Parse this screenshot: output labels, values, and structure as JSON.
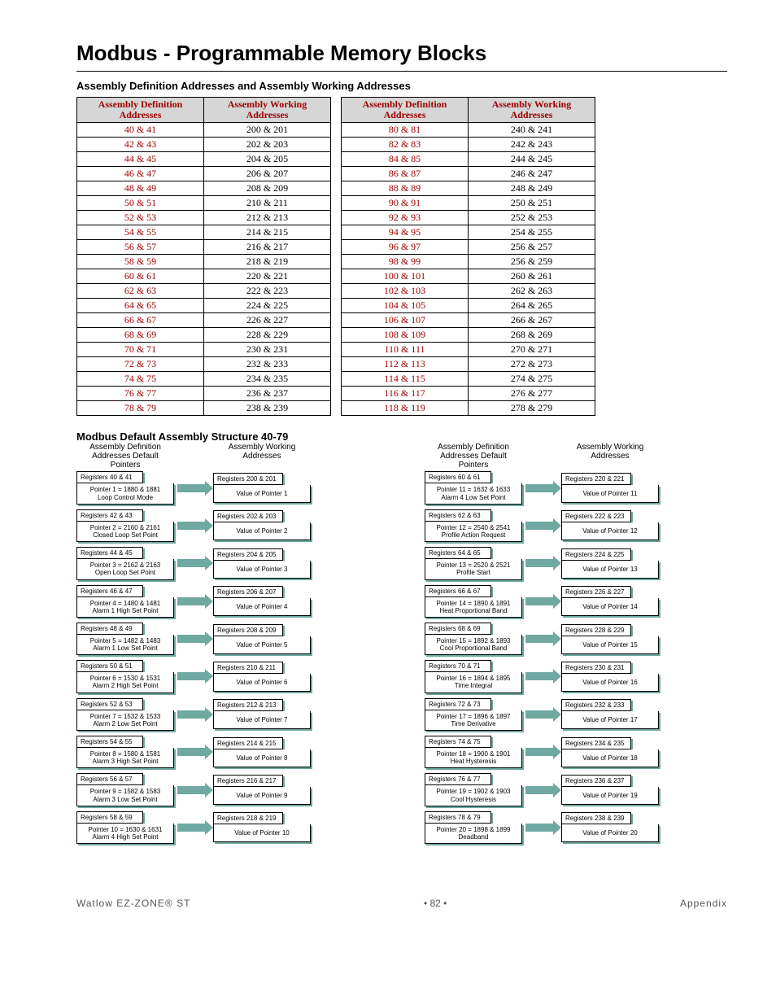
{
  "title": "Modbus - Programmable Memory Blocks",
  "subtitle1": "Assembly Definition Addresses and Assembly Working Addresses",
  "th_def": "Assembly Definition Addresses",
  "th_wrk": "Assembly Working Addresses",
  "tableA": [
    {
      "d": "40 & 41",
      "w": "200 & 201"
    },
    {
      "d": "42 & 43",
      "w": "202 & 203"
    },
    {
      "d": "44 & 45",
      "w": "204 & 205"
    },
    {
      "d": "46 & 47",
      "w": "206 & 207"
    },
    {
      "d": "48 & 49",
      "w": "208 & 209"
    },
    {
      "d": "50 & 51",
      "w": "210 & 211"
    },
    {
      "d": "52 & 53",
      "w": "212 & 213"
    },
    {
      "d": "54 & 55",
      "w": "214 & 215"
    },
    {
      "d": "56 & 57",
      "w": "216 & 217"
    },
    {
      "d": "58 & 59",
      "w": "218 & 219"
    },
    {
      "d": "60 & 61",
      "w": "220 & 221"
    },
    {
      "d": "62 & 63",
      "w": "222 & 223"
    },
    {
      "d": "64 & 65",
      "w": "224 & 225"
    },
    {
      "d": "66 & 67",
      "w": "226 & 227"
    },
    {
      "d": "68 & 69",
      "w": "228 & 229"
    },
    {
      "d": "70 & 71",
      "w": "230 & 231"
    },
    {
      "d": "72 & 73",
      "w": "232 & 233"
    },
    {
      "d": "74 & 75",
      "w": "234 & 235"
    },
    {
      "d": "76 & 77",
      "w": "236 & 237"
    },
    {
      "d": "78 & 79",
      "w": "238 & 239"
    }
  ],
  "tableB": [
    {
      "d": "80 & 81",
      "w": "240 & 241"
    },
    {
      "d": "82 & 83",
      "w": "242 & 243"
    },
    {
      "d": "84 & 85",
      "w": "244 & 245"
    },
    {
      "d": "86 & 87",
      "w": "246 & 247"
    },
    {
      "d": "88 & 89",
      "w": "248 & 249"
    },
    {
      "d": "90 & 91",
      "w": "250 & 251"
    },
    {
      "d": "92 & 93",
      "w": "252 & 253"
    },
    {
      "d": "94 & 95",
      "w": "254 & 255"
    },
    {
      "d": "96 & 97",
      "w": "256 & 257"
    },
    {
      "d": "98 & 99",
      "w": "256 & 259"
    },
    {
      "d": "100 & 101",
      "w": "260 & 261"
    },
    {
      "d": "102 & 103",
      "w": "262 & 263"
    },
    {
      "d": "104 & 105",
      "w": "264 & 265"
    },
    {
      "d": "106 & 107",
      "w": "266 & 267"
    },
    {
      "d": "108 & 109",
      "w": "268 & 269"
    },
    {
      "d": "110 & 111",
      "w": "270 & 271"
    },
    {
      "d": "112 & 113",
      "w": "272 & 273"
    },
    {
      "d": "114 & 115",
      "w": "274 & 275"
    },
    {
      "d": "116 & 117",
      "w": "276 & 277"
    },
    {
      "d": "118 & 119",
      "w": "278 & 279"
    }
  ],
  "subtitle2": "Modbus Default Assembly Structure 40-79",
  "head_def": "Assembly Definition Addresses Default Pointers",
  "head_wrk": "Assembly Working Addresses",
  "colA": [
    {
      "reg": "Registers 40 & 41",
      "ptr": "Pointer 1 = 1880 & 1881\nLoop Control Mode",
      "wreg": "Registers 200 & 201",
      "val": "Value of Pointer 1"
    },
    {
      "reg": "Registers 42 & 43",
      "ptr": "Pointer 2 = 2160 & 2161\nClosed Loop Set Point",
      "wreg": "Registers 202 & 203",
      "val": "Value of Pointer 2"
    },
    {
      "reg": "Registers 44 & 45",
      "ptr": "Pointer 3 = 2162 & 2163\nOpen Loop Set Point",
      "wreg": "Registers 204 & 205",
      "val": "Value of Pointer 3"
    },
    {
      "reg": "Registers 46 & 47",
      "ptr": "Pointer 4 = 1480 & 1481\nAlarm 1 High Set Point",
      "wreg": "Registers 206 & 207",
      "val": "Value of Pointer 4"
    },
    {
      "reg": "Registers 48 & 49",
      "ptr": "Pointer 5 = 1482 & 1483\nAlarm 1 Low Set Point",
      "wreg": "Registers 208 & 209",
      "val": "Value of Pointer 5"
    },
    {
      "reg": "Registers 50 & 51",
      "ptr": "Pointer 6 = 1530 & 1531\nAlarm 2 High Set Point",
      "wreg": "Registers 210 & 211",
      "val": "Value of Pointer 6"
    },
    {
      "reg": "Registers 52 & 53",
      "ptr": "Pointer 7 = 1532 & 1533\nAlarm 2 Low Set Point",
      "wreg": "Registers 212 & 213",
      "val": "Value of Pointer 7"
    },
    {
      "reg": "Registers 54 & 55",
      "ptr": "Pointer 8 = 1580 & 1581\nAlarm 3 High Set Point",
      "wreg": "Registers 214 & 215",
      "val": "Value of Pointer 8"
    },
    {
      "reg": "Registers 56 & 57",
      "ptr": "Pointer 9 = 1582 & 1583\nAlarm 3 Low Set Point",
      "wreg": "Registers 216 & 217",
      "val": "Value of Pointer 9"
    },
    {
      "reg": "Registers 58 & 59",
      "ptr": "Pointer 10 = 1630 & 1631\nAlarm 4 High Set Point",
      "wreg": "Registers 218 & 219",
      "val": "Value of Pointer 10"
    }
  ],
  "colB": [
    {
      "reg": "Registers 60 & 61",
      "ptr": "Pointer 11 = 1632 & 1633\nAlarm 4 Low Set Point",
      "wreg": "Registers 220 & 221",
      "val": "Value of Pointer 11"
    },
    {
      "reg": "Registers 62 & 63",
      "ptr": "Pointer 12 = 2540 & 2541\nProfile Action Request",
      "wreg": "Registers 222 & 223",
      "val": "Value of Pointer 12"
    },
    {
      "reg": "Registers 64 & 65",
      "ptr": "Pointer 13 = 2520 & 2521\nProfile Start",
      "wreg": "Registers 224 & 225",
      "val": "Value of Pointer 13"
    },
    {
      "reg": "Registers 66 & 67",
      "ptr": "Pointer 14 = 1890 & 1891\nHeat Proportional Band",
      "wreg": "Registers 226 & 227",
      "val": "Value of Pointer 14"
    },
    {
      "reg": "Registers 68 & 69",
      "ptr": "Pointer 15 = 1892 & 1893\nCool Proportional Band",
      "wreg": "Registers 228 & 229",
      "val": "Value of Pointer 15"
    },
    {
      "reg": "Registers 70 & 71",
      "ptr": "Pointer 16 = 1894 & 1895\nTime Integral",
      "wreg": "Registers 230 & 231",
      "val": "Value of Pointer 16"
    },
    {
      "reg": "Registers 72 & 73",
      "ptr": "Pointer 17 = 1896 & 1897\nTime Derivative",
      "wreg": "Registers 232 & 233",
      "val": "Value of Pointer 17"
    },
    {
      "reg": "Registers 74 & 75",
      "ptr": "Pointer 18 = 1900 & 1901\nHeat Hysteresis",
      "wreg": "Registers 234 & 235",
      "val": "Value of Pointer 18"
    },
    {
      "reg": "Registers 76 & 77",
      "ptr": "Pointer 19 = 1902 & 1903\nCool Hysteresis",
      "wreg": "Registers 236 & 237",
      "val": "Value of Pointer 19"
    },
    {
      "reg": "Registers 78 & 79",
      "ptr": "Pointer 20 = 1898 & 1899\nDeadband",
      "wreg": "Registers 238 & 239",
      "val": "Value of Pointer 20"
    }
  ],
  "footer": {
    "left": "Watlow EZ-ZONE® ST",
    "mid": "•  82  •",
    "right": "Appendix"
  }
}
